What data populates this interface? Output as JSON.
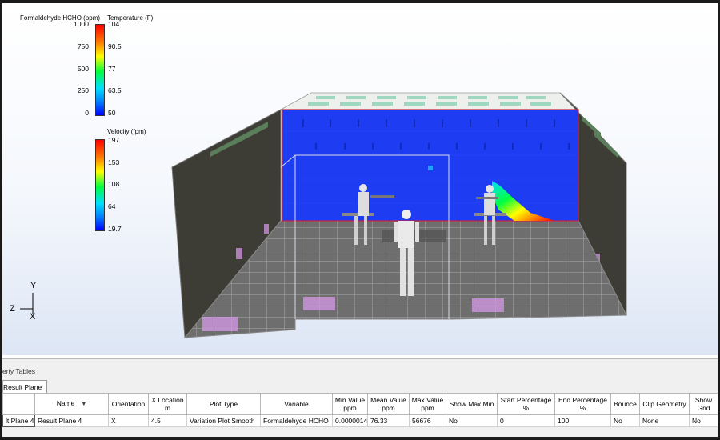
{
  "legend_hcho": {
    "title_left": "Formaldehyde HCHO (ppm)",
    "title_right": "Temperature (F)",
    "left_ticks": [
      "1000",
      "750",
      "500",
      "250",
      "0"
    ],
    "right_ticks": [
      "104",
      "90.5",
      "77",
      "63.5",
      "50"
    ]
  },
  "legend_velocity": {
    "title": "Velocity (fpm)",
    "ticks": [
      "197",
      "153",
      "108",
      "64",
      "19.7"
    ]
  },
  "axes": {
    "y": "Y",
    "z": "Z",
    "x": "X"
  },
  "colors": {
    "scale_top": "#ff0000",
    "scale_mid": "#00ff40",
    "scale_bottom": "#0000ff",
    "plane": "#1f3ff5",
    "floor": "#6b6b6b",
    "wall": "#3c3c34"
  },
  "panel": {
    "title": "erty Tables",
    "tab_label": "Result Plane",
    "columns": [
      {
        "label": ""
      },
      {
        "label": "Name",
        "sortable": true
      },
      {
        "label": "Orientation"
      },
      {
        "label": "X Location",
        "sub": "m"
      },
      {
        "label": "Plot Type"
      },
      {
        "label": "Variable"
      },
      {
        "label": "Min Value",
        "sub": "ppm"
      },
      {
        "label": "Mean Value",
        "sub": "ppm"
      },
      {
        "label": "Max Value",
        "sub": "ppm"
      },
      {
        "label": "Show Max Min"
      },
      {
        "label": "Start Percentage",
        "sub": "%"
      },
      {
        "label": "End Percentage",
        "sub": "%"
      },
      {
        "label": "Bounce"
      },
      {
        "label": "Clip Geometry"
      },
      {
        "label": "Show Grid"
      }
    ],
    "row": [
      "lt Plane 4",
      "Result Plane 4",
      "X",
      "4.5",
      "Variation Plot Smooth",
      "Formaldehyde HCHO",
      "0.0000014",
      "76.33",
      "56676",
      "No",
      "0",
      "100",
      "No",
      "None",
      "No"
    ]
  }
}
